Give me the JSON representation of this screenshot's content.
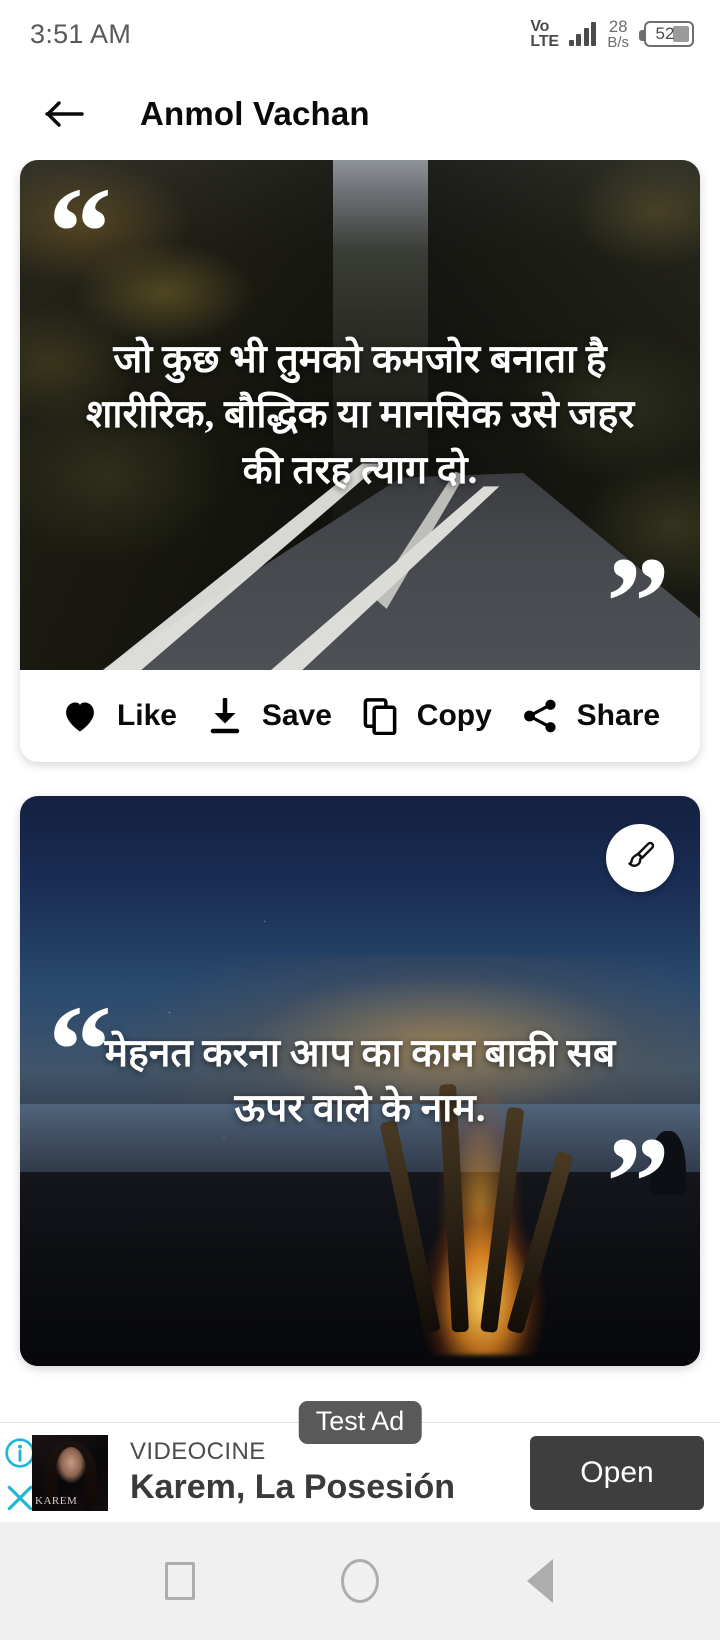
{
  "status_bar": {
    "time": "3:51 AM",
    "network_type_line1": "Vo",
    "network_type_line2": "LTE",
    "net_speed_value": "28",
    "net_speed_unit": "B/s",
    "battery_level": "52",
    "icons": [
      "signal-icon",
      "battery-icon"
    ]
  },
  "app_bar": {
    "back_icon": "back-arrow-icon",
    "title": "Anmol Vachan"
  },
  "cards": [
    {
      "quote": "जो कुछ भी तुमको कमजोर बनाता है शारीरिक, बौद्धिक या मानसिक उसे जहर की तरह त्याग दो.",
      "open_quote": "“",
      "close_quote": "”",
      "background": "forest-road-photo",
      "actions": [
        {
          "label": "Like",
          "icon": "heart-icon"
        },
        {
          "label": "Save",
          "icon": "download-icon"
        },
        {
          "label": "Copy",
          "icon": "copy-icon"
        },
        {
          "label": "Share",
          "icon": "share-icon"
        }
      ]
    },
    {
      "quote": "मेहनत करना आप का काम बाकी सब ऊपर वाले के नाम.",
      "open_quote": "“",
      "close_quote": "”",
      "background": "campfire-dusk-photo",
      "brush_icon": "paintbrush-icon"
    }
  ],
  "ad": {
    "badge": "Test Ad",
    "advertiser": "VIDEOCINE",
    "headline": "Karem, La Posesión",
    "cta_label": "Open",
    "info_icon": "info-icon",
    "close_icon": "close-icon",
    "thumb_watermark": "KAREM"
  },
  "nav_bar": {
    "buttons": [
      {
        "name": "recents",
        "icon": "square-icon"
      },
      {
        "name": "home",
        "icon": "circle-icon"
      },
      {
        "name": "back",
        "icon": "triangle-icon"
      }
    ]
  },
  "colors": {
    "accent_cyan": "#21b6d6",
    "ad_cta_bg": "#3e3e3e",
    "badge_bg": "#595959",
    "nav_bg": "#f0f0f0",
    "text_dark": "#0a0a0a"
  }
}
